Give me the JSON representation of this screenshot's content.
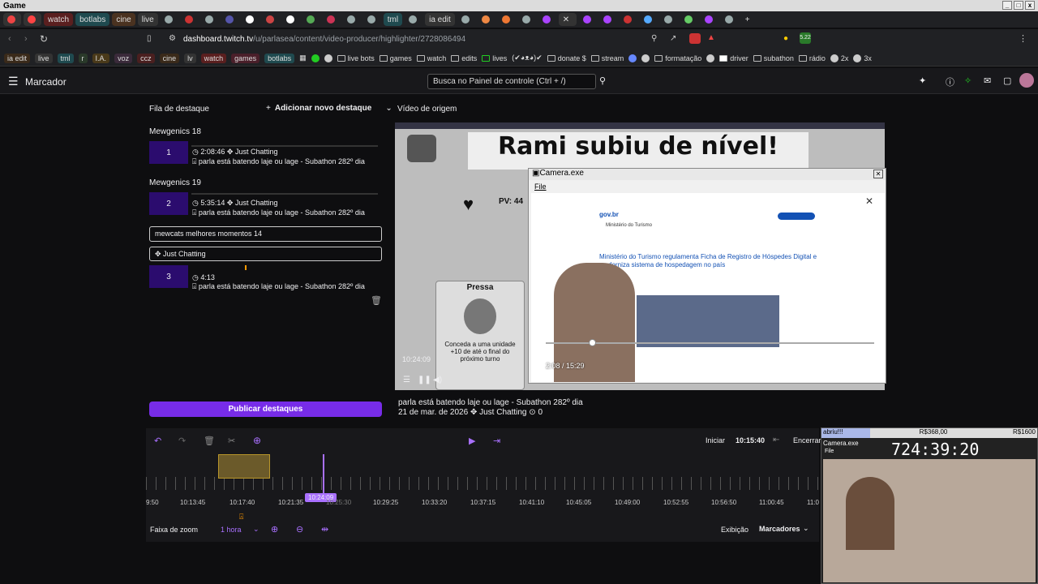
{
  "window": {
    "title": "Game"
  },
  "tabs": [
    {
      "label": "watch"
    },
    {
      "label": "botlabs"
    },
    {
      "label": "cine"
    },
    {
      "label": "live"
    },
    {
      "label": "tml"
    },
    {
      "label": "ia edit"
    }
  ],
  "browser": {
    "url_host": "dashboard.twitch.tv",
    "url_path": "/u/parlasea/content/video-producer/highlighter/2728086494"
  },
  "bookmarks": [
    "ia edit",
    "live",
    "tml",
    "r",
    "I.A.",
    "voz",
    "ccz",
    "cine",
    "lv",
    "watch",
    "games",
    "botlabs",
    "live bots",
    "games",
    "watch",
    "edits",
    "lives",
    "(✔◕ᴥ◕)✔",
    "donate $",
    "stream",
    "formatação",
    "driver",
    "subathon",
    "rádio",
    "2x",
    "3x"
  ],
  "header": {
    "title": "Marcador",
    "search_placeholder": "Busca no Painel de controle (Ctrl + /)"
  },
  "queue": {
    "title": "Fila de destaque",
    "add_label": "Adicionar novo destaque",
    "publish_label": "Publicar destaques",
    "items": [
      {
        "group": "Mewgenics 18",
        "num": "1",
        "duration": "2:08:46",
        "category": "Just Chatting",
        "title": "parla está batendo laje ou lage - Subathon 282º dia"
      },
      {
        "group": "Mewgenics 19",
        "num": "2",
        "duration": "5:35:14",
        "category": "Just Chatting",
        "title": "parla está batendo laje ou lage - Subathon 282º dia"
      },
      {
        "group": "mewcats melhores momentos 14",
        "num": "3",
        "duration": "4:13",
        "category": "Just Chatting",
        "title": "parla está batendo laje ou lage - Subathon 282º dia"
      }
    ]
  },
  "source": {
    "title": "Vídeo de origem",
    "video_title": "parla está batendo laje ou lage - Subathon 282º dia",
    "date": "21 de mar. de 2026",
    "category": "Just Chatting",
    "views": "0",
    "time": "10:24:09"
  },
  "game": {
    "banner": "Rami subiu de nível!",
    "pv": "PV: 44",
    "pressa": "Pressa",
    "card": "Conceda a uma unidade +10 de até o final do próximo turno"
  },
  "camera": {
    "title": "Camera.exe",
    "menu": "File",
    "time": "2:08 / 15:29",
    "page_title": "Ministério do Turismo regulamenta Ficha de Registro de Hóspedes Digital e moderniza sistema de hospedagem no país",
    "gov": "gov.br",
    "org": "Ministério do Turismo"
  },
  "timeline": {
    "start_label": "Iniciar",
    "start_time": "10:15:40",
    "end_label": "Encerrar",
    "playhead": "10:24:09",
    "zoom_label": "Faixa de zoom",
    "zoom_value": "1 hora",
    "view_label": "Exibição",
    "view_value": "Marcadores",
    "ticks": [
      "9:50",
      "10:13:45",
      "10:17:40",
      "10:21:35",
      "10:25:30",
      "10:29:25",
      "10:33:20",
      "10:37:15",
      "10:41:10",
      "10:45:05",
      "10:49:00",
      "10:52:55",
      "10:56:50",
      "11:00:45",
      "11:0"
    ]
  },
  "stream_overlay": {
    "left": "abriu!!!",
    "mid": "R$368,00",
    "right": "R$1600",
    "cam_title": "Camera.exe",
    "menu": "File",
    "timer": "724:39:20"
  }
}
